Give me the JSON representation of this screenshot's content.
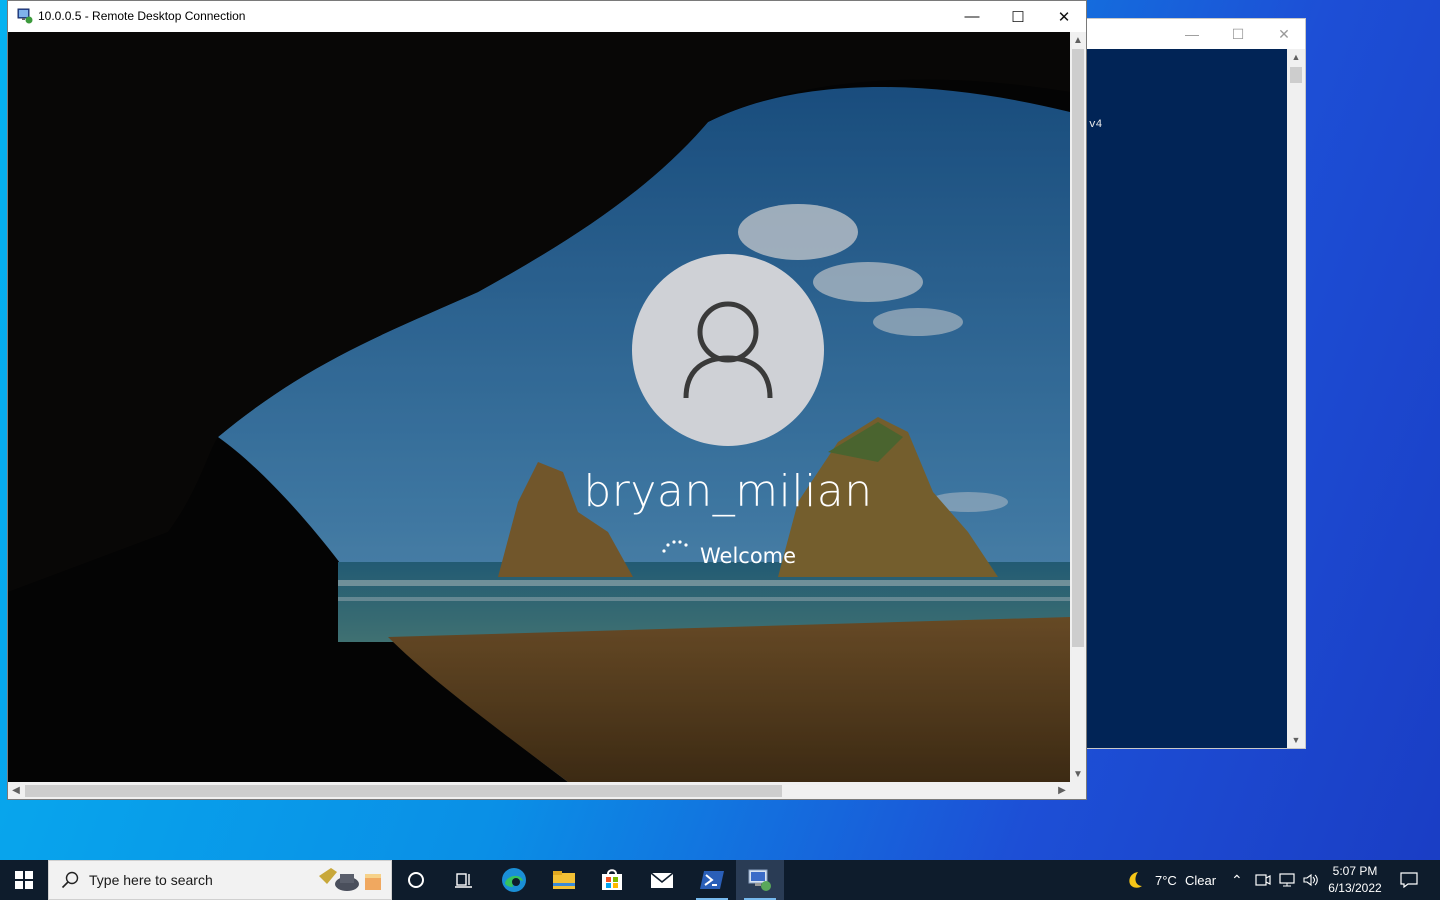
{
  "rdp_window": {
    "title": "10.0.0.5 - Remote Desktop Connection",
    "minimize_label": "—",
    "maximize_label": "☐",
    "close_label": "✕"
  },
  "login_screen": {
    "username": "bryan_milian",
    "status": "Welcome"
  },
  "powershell_window": {
    "visible_text": "v4"
  },
  "taskbar": {
    "search_placeholder": "Type here to search",
    "apps": [
      "cortana-icon",
      "task-view-icon",
      "edge-icon",
      "file-explorer-icon",
      "store-icon",
      "mail-icon",
      "powershell-icon",
      "remote-desktop-icon"
    ],
    "weather_temp": "7°C",
    "weather_cond": "Clear",
    "clock_time": "5:07 PM",
    "clock_date": "6/13/2022"
  },
  "colors": {
    "taskbar": "#0e1c2c",
    "powershell_bg": "#012456",
    "desktop_blue": "#0a8fe6"
  }
}
